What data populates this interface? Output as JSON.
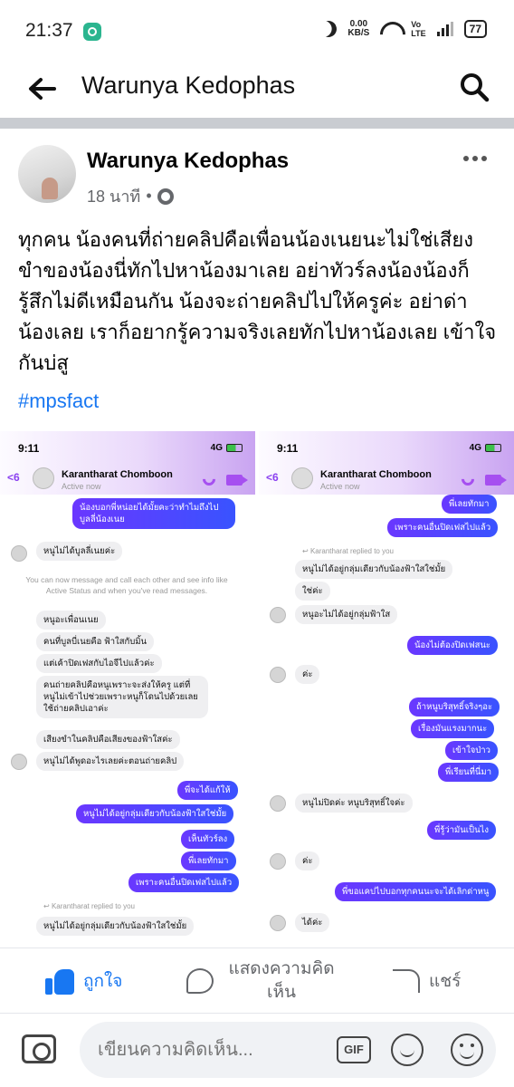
{
  "status_bar": {
    "time": "21:37",
    "speed": "0.00",
    "speed_unit": "KB/S",
    "volte_top": "Vo",
    "volte_bottom": "LTE",
    "battery": "77"
  },
  "nav": {
    "title": "Warunya Kedophas"
  },
  "post": {
    "author": "Warunya Kedophas",
    "time": "18 นาที",
    "separator": "•",
    "text": "ทุกคน น้องคนที่ถ่ายคลิปคือเพื่อนน้องเนยนะไม่ใช่เสียงขำของน้องนี่ทักไปหาน้องมาเลย อย่าทัวร์ลงน้องน้องก็รู้สึกไม่ดีเหมือนกัน น้องจะถ่ายคลิปไปให้ครูค่ะ อย่าด่าน้องเลย เราก็อยากรู้ความจริงเลยทักไปหาน้องเลย เข้าใจกันบ่สู",
    "hashtag": "#mpsfact"
  },
  "screens": {
    "left": {
      "time": "9:11",
      "network": "4G",
      "back_count": "6",
      "contact": "Karantharat Chomboon",
      "active": "Active now",
      "messages": {
        "m1": "น้องบอกพี่หน่อยได้มั้ยคะว่าทำไมถึงไปบูลลี่น้องเนย",
        "m2": "หนูไม่ได้บูลลี่เนยค่ะ",
        "sys": "You can now message and call each other and see info like Active Status and when you've read messages.",
        "m3": "หนูอะเพื่อนเนย",
        "m4": "คนที่บูลบี่เนยคือ ฟ้าใสกับมิ้น",
        "m5": "แต่เค้าปิดเฟสกับไอจีไปแล้วค่ะ",
        "m6": "คนถ่ายคลิปคือหนูเพราะจะส่งให้ครู แต่ที่หนูไม่เข้าไปช่วยเพราะหนูก็โดนไปด้วยเลยใช้ถ่ายคลิปเอาค่ะ",
        "m7": "เสียงขำในคลิปคือเสียงของฟ้าใสค่ะ",
        "m8": "หนูไม่ได้พูดอะไรเลยค่ะตอนถ่ายคลิป",
        "m9": "พี่จะได้แก้ให้",
        "m10": "หนูไม่ได้อยู่กลุ่มเดียวกับน้องฟ้าใสใช่มั้ย",
        "m11": "เห็นทัวร์ลง",
        "m12": "พี่เลยทักมา",
        "m13": "เพราะคนอื่นปิดเฟสไปแล้ว",
        "reply": "Karantharat replied to you",
        "m14": "หนูไม่ได้อยู่กลุ่มเดียวกับน้องฟ้าใสใช่มั้ย"
      }
    },
    "right": {
      "time": "9:11",
      "network": "4G",
      "back_count": "6",
      "contact": "Karantharat Chomboon",
      "active": "Active now",
      "messages": {
        "r1": "พี่เลยทักมา",
        "r2": "เพราะคนอื่นปิดเฟสไปแล้ว",
        "reply": "Karantharat replied to you",
        "r3": "หนูไม่ได้อยู่กลุ่มเดียวกับน้องฟ้าใสใช่มั้ย",
        "r4": "ใช่ค่ะ",
        "r5": "หนูอะไม่ได้อยู่กลุ่มฟ้าใส",
        "r6": "น้องไม่ต้องปิดเฟสนะ",
        "r7": "ค่ะ",
        "r8": "ถ้าหนูบริสุทธิ์จริงๆอะ",
        "r9": "เรื่องมันแรงมากนะ",
        "r10": "เข้าใจป่าว",
        "r11": "พี่เรียนที่นี่มา",
        "r12": "หนูไม่ปิดค่ะ หนูบริสุทธิ์ใจค่ะ",
        "r13": "พี่รู้ว่ามันเป็นไง",
        "r14": "ค่ะ",
        "r15": "พี่ขอแคปไปบอกทุกคนนะจะได้เลิกด่าหนู",
        "r16": "ได้ค่ะ"
      }
    }
  },
  "actions": {
    "like": "ถูกใจ",
    "comment": "แสดงความคิดเห็น",
    "share": "แชร์"
  },
  "composer": {
    "placeholder": "เขียนความคิดเห็น..."
  },
  "icons": [
    "back-arrow-icon",
    "search-icon",
    "more-icon",
    "globe-icon",
    "like-icon",
    "comment-icon",
    "share-icon",
    "camera-icon",
    "gif-icon",
    "sticker-icon",
    "emoji-icon"
  ],
  "colors": {
    "facebook_blue": "#1877f2",
    "messenger_purple": "#a64ff0",
    "bubble_out": "#4a45ff"
  }
}
